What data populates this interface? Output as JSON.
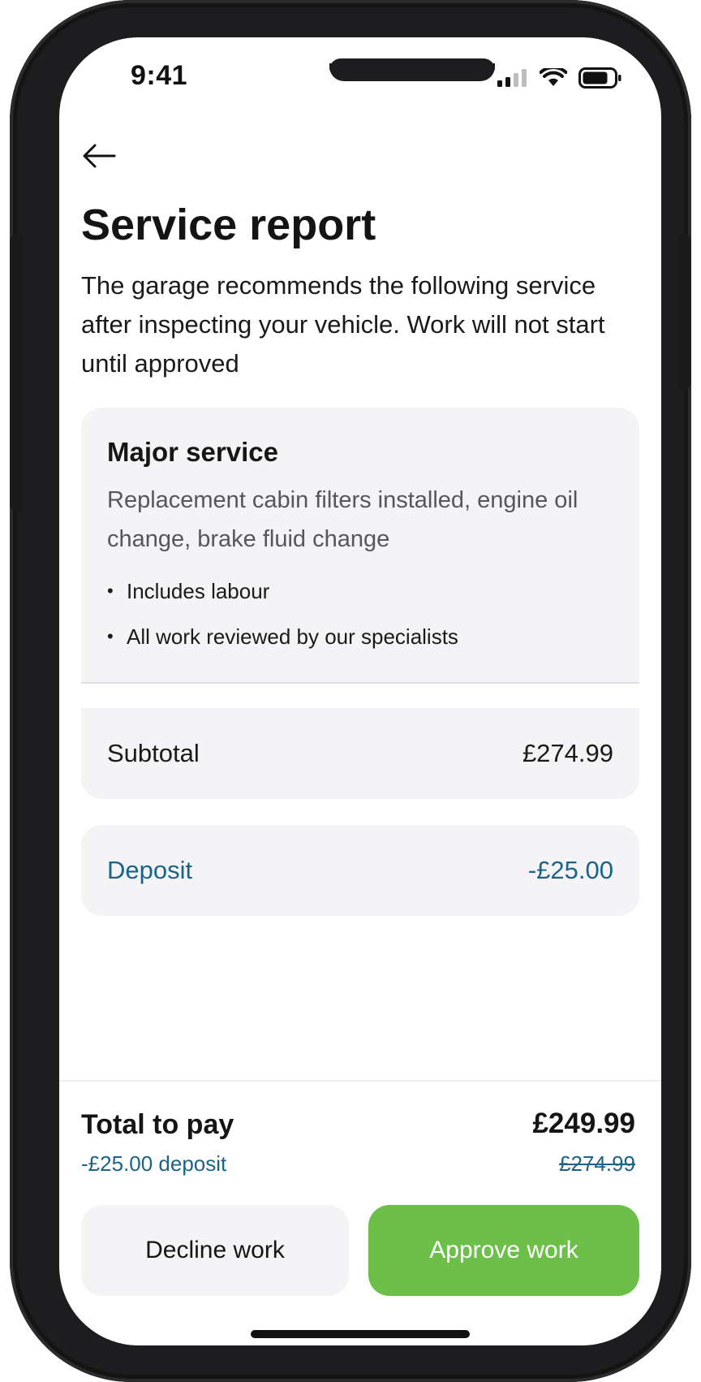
{
  "status_bar": {
    "time": "9:41",
    "icons": [
      "cellular-signal-icon",
      "wifi-icon",
      "battery-icon"
    ]
  },
  "nav": {
    "back_icon": "arrow-left-icon"
  },
  "page": {
    "title": "Service report",
    "intro": "The garage recommends the following service after inspecting your vehicle. Work will not start until approved"
  },
  "service": {
    "name": "Major service",
    "description": "Replacement cabin filters installed, engine oil change, brake fluid change",
    "bullets": [
      "Includes labour",
      "All work reviewed by our specialists"
    ]
  },
  "summary": {
    "subtotal_label": "Subtotal",
    "subtotal_value": "£274.99",
    "deposit_label": "Deposit",
    "deposit_value": "-£25.00"
  },
  "footer": {
    "total_label": "Total to pay",
    "total_value": "£249.99",
    "deposit_note": "-£25.00 deposit",
    "original_value": "£274.99",
    "decline_label": "Decline work",
    "approve_label": "Approve work"
  },
  "colors": {
    "accent_green": "#6cc04a",
    "link_blue": "#1b6487",
    "card_bg": "#f4f4f6",
    "text": "#151515"
  }
}
